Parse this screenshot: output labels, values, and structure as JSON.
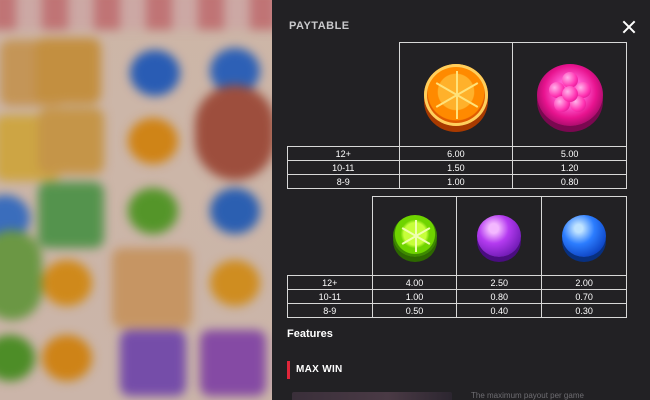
{
  "panel": {
    "title": "PAYTABLE",
    "close_icon": "close-icon"
  },
  "table1": {
    "symbols": [
      {
        "name": "orange-candy-icon",
        "color": "#ff8a00"
      },
      {
        "name": "raspberry-candy-icon",
        "color": "#e8138f"
      }
    ],
    "rows": [
      {
        "count": "12+",
        "values": [
          "6.00",
          "5.00"
        ]
      },
      {
        "count": "10-11",
        "values": [
          "1.50",
          "1.20"
        ]
      },
      {
        "count": "8-9",
        "values": [
          "1.00",
          "0.80"
        ]
      }
    ]
  },
  "table2": {
    "symbols": [
      {
        "name": "lime-candy-icon",
        "color": "#6fd400"
      },
      {
        "name": "grape-candy-icon",
        "color": "#b43bf0"
      },
      {
        "name": "blueberry-candy-icon",
        "color": "#2c7dff"
      }
    ],
    "rows": [
      {
        "count": "12+",
        "values": [
          "4.00",
          "2.50",
          "2.00"
        ]
      },
      {
        "count": "10-11",
        "values": [
          "1.00",
          "0.80",
          "0.70"
        ]
      },
      {
        "count": "8-9",
        "values": [
          "0.50",
          "0.40",
          "0.30"
        ]
      }
    ]
  },
  "features": {
    "heading": "Features",
    "max_win_title": "MAX WIN",
    "max_win_desc": "The maximum payout per game"
  },
  "colors": {
    "panel_bg": "#222124",
    "accent_red": "#e0263a"
  }
}
